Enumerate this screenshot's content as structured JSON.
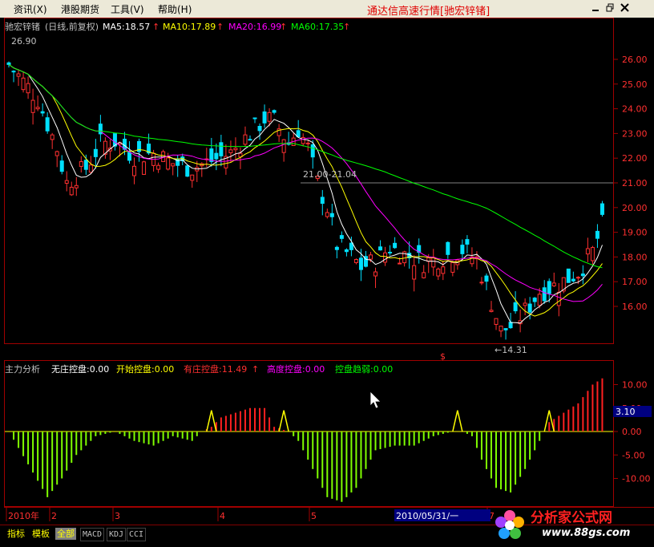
{
  "menu": {
    "items": [
      "资讯(X)",
      "港股期货",
      "工具(V)",
      "帮助(H)"
    ],
    "app_title": "通达信高速行情[驰宏锌锗]"
  },
  "price_panel": {
    "stock_name": "驰宏锌锗",
    "period": "(日线,前复权)",
    "ma": [
      {
        "label": "MA5:18.57",
        "color": "#ffffff"
      },
      {
        "label": "MA10:17.89",
        "color": "#ffff00"
      },
      {
        "label": "MA20:16.99",
        "color": "#ff00ff"
      },
      {
        "label": "MA60:17.35",
        "color": "#00ff00"
      }
    ],
    "high_marker": "26.90",
    "low_marker": "←14.31",
    "range_marker": "21.00-21.04",
    "axis_ticks": [
      "26.00",
      "25.00",
      "24.00",
      "23.00",
      "22.00",
      "21.00",
      "20.00",
      "19.00",
      "18.00",
      "17.00",
      "16.00"
    ]
  },
  "indicator_panel": {
    "name": "主力分析",
    "stats": [
      {
        "label": "无庄控盘:0.00",
        "color": "#ffffff"
      },
      {
        "label": "开始控盘:0.00",
        "color": "#ffff00"
      },
      {
        "label": "有庄控盘:11.49",
        "color": "#ff3030"
      },
      {
        "label": "高度控盘:0.00",
        "color": "#ff00ff"
      },
      {
        "label": "控盘趋弱:0.00",
        "color": "#00ff00"
      }
    ],
    "current_value": "3.10",
    "axis_ticks": [
      "10.00",
      "5.00",
      "0.00",
      "-5.00",
      "-10.00"
    ]
  },
  "time_axis": {
    "labels": [
      "2010年",
      "2",
      "3",
      "4",
      "5",
      "7"
    ],
    "cursor_date": "2010/05/31/一"
  },
  "tabs": [
    "指标",
    "模板",
    "全部",
    "MACD",
    "KDJ",
    "CCI"
  ],
  "logo": {
    "text": "分析家公式网",
    "url_text": "www.88gs.com"
  }
}
